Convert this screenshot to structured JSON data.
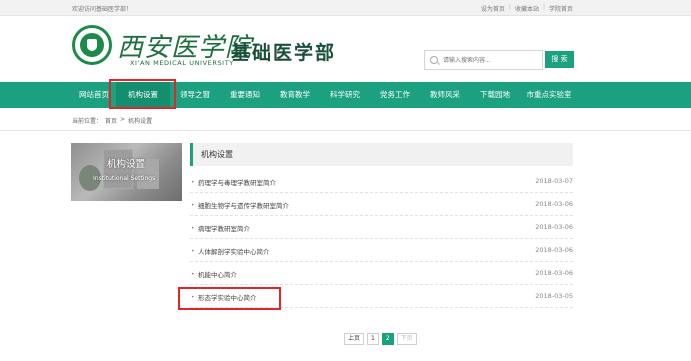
{
  "topbar": {
    "welcome": "欢迎访问基础医学部！",
    "links": [
      "设为首页",
      "收藏本站",
      "学院首页"
    ]
  },
  "header": {
    "logo_cn": "西安医学院",
    "logo_en": "XI'AN MEDICAL UNIVERSITY",
    "dept_title": "基础医学部",
    "search_placeholder": "请输入搜索内容...",
    "search_button": "搜 索"
  },
  "nav": {
    "items": [
      "网站首页",
      "机构设置",
      "领导之窗",
      "重要通知",
      "教育教学",
      "科学研究",
      "党务工作",
      "教师风采",
      "下载园地",
      "市重点实验室"
    ],
    "active_index": 1
  },
  "breadcrumb": {
    "prefix": "当前位置：",
    "home": "首页",
    "separator": ">",
    "current": "机构设置"
  },
  "banner": {
    "title_cn": "机构设置",
    "title_en": "Institutional Settings"
  },
  "panel": {
    "heading": "机构设置",
    "rows": [
      {
        "title": "药理学与毒理学教研室简介",
        "date": "2018-03-07"
      },
      {
        "title": "细胞生物学与遗传学教研室简介",
        "date": "2018-03-06"
      },
      {
        "title": "病理学教研室简介",
        "date": "2018-03-06"
      },
      {
        "title": "人体解剖学实验中心简介",
        "date": "2018-03-06"
      },
      {
        "title": "机能中心简介",
        "date": "2018-03-06"
      },
      {
        "title": "形态学实验中心简介",
        "date": "2018-03-05"
      }
    ]
  },
  "pager": {
    "prev": "上页",
    "pages": [
      "1",
      "2"
    ],
    "next": "下页"
  },
  "colors": {
    "nav_green": "#1ba180",
    "highlight_red": "#e0262a",
    "logo_green": "#1d6f3f"
  }
}
